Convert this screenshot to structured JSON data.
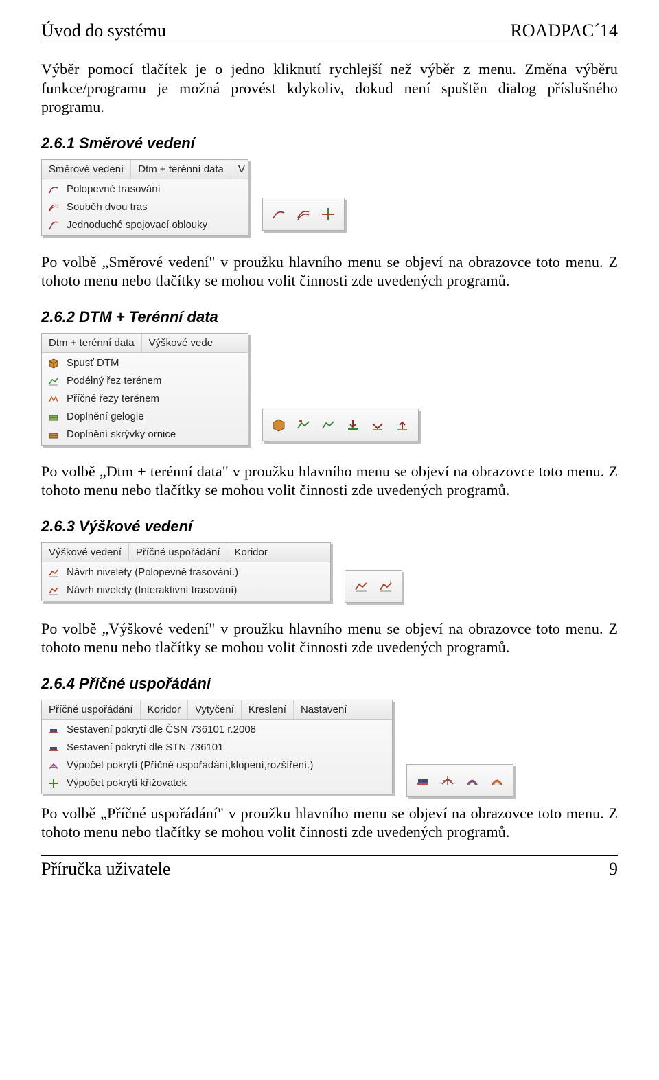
{
  "header": {
    "left": "Úvod do systému",
    "right": "ROADPAC´14"
  },
  "footer": {
    "left": "Příručka uživatele",
    "right": "9"
  },
  "intro_paragraph": "Výběr pomocí tlačítek je o jedno kliknutí rychlejší než výběr z menu. Změna výběru funkce/programu je možná provést kdykoliv, dokud není spuštěn dialog příslušného programu.",
  "s261": {
    "heading": "2.6.1  Směrové vedení",
    "menu_tabs": {
      "a": "Směrové vedení",
      "b": "Dtm + terénní data",
      "c": "V"
    },
    "menu_items": {
      "a": "Polopevné trasování",
      "b": "Souběh dvou tras",
      "c": "Jednoduché spojovací oblouky"
    },
    "paragraph": "Po volbě „Směrové vedení\" v proužku hlavního menu se objeví na obrazovce toto menu. Z tohoto menu nebo tlačítky se mohou volit činnosti zde uvedených programů."
  },
  "s262": {
    "heading": "2.6.2  DTM + Terénní data",
    "menu_tabs": {
      "a": "Dtm + terénní data",
      "b": "Výškové vede"
    },
    "menu_items": {
      "a": "Spusť DTM",
      "b": "Podélný řez terénem",
      "c": "Příčné řezy terénem",
      "d": "Doplnění gelogie",
      "e": "Doplnění skrývky ornice"
    },
    "paragraph": "Po volbě „Dtm + terénní data\" v proužku hlavního menu se objeví na obrazovce toto menu. Z tohoto menu nebo tlačítky se mohou volit činnosti zde uvedených programů."
  },
  "s263": {
    "heading": "2.6.3  Výškové vedení",
    "menu_tabs": {
      "a": "Výškové vedení",
      "b": "Příčné uspořádání",
      "c": "Koridor"
    },
    "menu_items": {
      "a": "Návrh nivelety (Polopevné trasování.)",
      "b": "Návrh nivelety (Interaktivní trasování)"
    },
    "paragraph": "Po volbě „Výškové vedení\" v proužku hlavního menu se objeví na obrazovce toto menu. Z tohoto menu nebo tlačítky se mohou volit činnosti zde uvedených programů."
  },
  "s264": {
    "heading": "2.6.4  Příčné uspořádání",
    "menu_tabs": {
      "a": "Příčné uspořádání",
      "b": "Koridor",
      "c": "Vytyčení",
      "d": "Kreslení",
      "e": "Nastavení"
    },
    "menu_items": {
      "a": "Sestavení pokrytí dle ČSN 736101 r.2008",
      "b": "Sestavení pokrytí dle STN 736101",
      "c": "Výpočet pokrytí (Příčné uspořádání,klopení,rozšíření.)",
      "d": "Výpočet pokrytí křižovatek"
    },
    "paragraph": "Po volbě „Příčné uspořádání\" v proužku hlavního menu se objeví na obrazovce toto menu. Z tohoto menu nebo tlačítky se mohou volit činnosti zde uvedených programů."
  }
}
